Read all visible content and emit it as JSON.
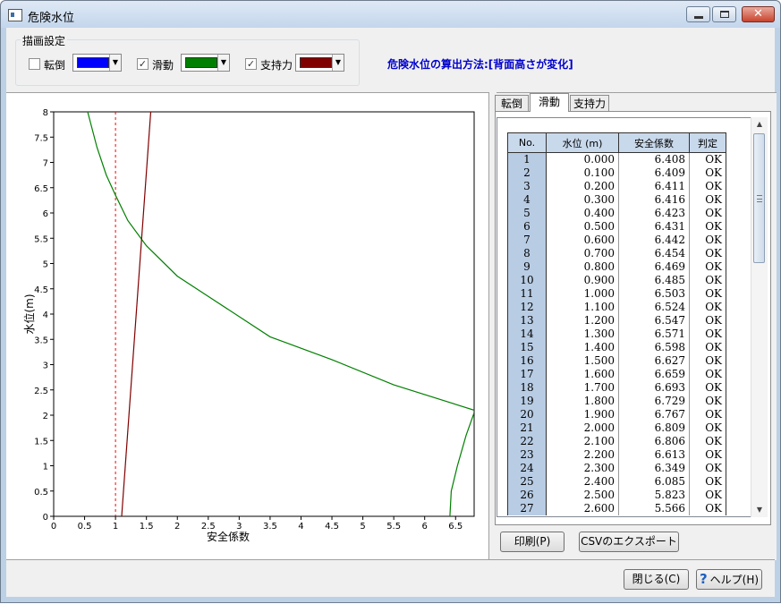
{
  "window": {
    "title": "危険水位",
    "minimize_glyph": "─",
    "maximize_glyph": "□",
    "close_glyph": "✕"
  },
  "settings": {
    "group_label": "描画設定",
    "items": [
      {
        "label": "転倒",
        "checked": false,
        "color": "#0000ff"
      },
      {
        "label": "滑動",
        "checked": true,
        "color": "#008000"
      },
      {
        "label": "支持力",
        "checked": true,
        "color": "#800000"
      }
    ],
    "check_glyph": "✓",
    "dropdown_glyph": "▼"
  },
  "method_text": "危険水位の算出方法:[背面高さが変化]",
  "chart_data": {
    "type": "line",
    "xlabel": "安全係数",
    "ylabel": "水位(m)",
    "xlim": [
      0,
      6.8
    ],
    "ylim": [
      0,
      8
    ],
    "x_ticks": [
      "0",
      "0.5",
      "1",
      "1.5",
      "2",
      "2.5",
      "3",
      "3.5",
      "4",
      "4.5",
      "5",
      "5.5",
      "6",
      "6.5"
    ],
    "y_ticks": [
      "0",
      "0.5",
      "1",
      "1.5",
      "2",
      "2.5",
      "3",
      "3.5",
      "4",
      "4.5",
      "5",
      "5.5",
      "6",
      "6.5",
      "7",
      "7.5",
      "8"
    ],
    "reference_x": 1.0,
    "series": [
      {
        "color": "#008000",
        "points": [
          [
            6.408,
            0
          ],
          [
            6.43,
            0.5
          ],
          [
            6.53,
            1
          ],
          [
            6.67,
            1.6
          ],
          [
            6.8,
            2.05
          ]
        ]
      },
      {
        "color": "#008000",
        "points": [
          [
            6.8,
            2.1
          ],
          [
            5.5,
            2.6
          ],
          [
            4.5,
            3.1
          ],
          [
            3.5,
            3.55
          ],
          [
            2.5,
            4.35
          ],
          [
            2.0,
            4.75
          ],
          [
            1.5,
            5.35
          ],
          [
            1.2,
            5.85
          ],
          [
            1.0,
            6.35
          ],
          [
            0.85,
            6.75
          ],
          [
            0.7,
            7.3
          ],
          [
            0.55,
            8
          ]
        ]
      },
      {
        "color": "#800000",
        "points": [
          [
            1.1,
            0
          ],
          [
            1.57,
            8
          ]
        ]
      }
    ]
  },
  "tabs": [
    {
      "label": "転倒"
    },
    {
      "label": "滑動"
    },
    {
      "label": "支持力"
    }
  ],
  "table": {
    "headers": [
      "No.",
      "水位 (m)",
      "安全係数",
      "判定"
    ],
    "rows": [
      [
        "1",
        "0.000",
        "6.408",
        "OK"
      ],
      [
        "2",
        "0.100",
        "6.409",
        "OK"
      ],
      [
        "3",
        "0.200",
        "6.411",
        "OK"
      ],
      [
        "4",
        "0.300",
        "6.416",
        "OK"
      ],
      [
        "5",
        "0.400",
        "6.423",
        "OK"
      ],
      [
        "6",
        "0.500",
        "6.431",
        "OK"
      ],
      [
        "7",
        "0.600",
        "6.442",
        "OK"
      ],
      [
        "8",
        "0.700",
        "6.454",
        "OK"
      ],
      [
        "9",
        "0.800",
        "6.469",
        "OK"
      ],
      [
        "10",
        "0.900",
        "6.485",
        "OK"
      ],
      [
        "11",
        "1.000",
        "6.503",
        "OK"
      ],
      [
        "12",
        "1.100",
        "6.524",
        "OK"
      ],
      [
        "13",
        "1.200",
        "6.547",
        "OK"
      ],
      [
        "14",
        "1.300",
        "6.571",
        "OK"
      ],
      [
        "15",
        "1.400",
        "6.598",
        "OK"
      ],
      [
        "16",
        "1.500",
        "6.627",
        "OK"
      ],
      [
        "17",
        "1.600",
        "6.659",
        "OK"
      ],
      [
        "18",
        "1.700",
        "6.693",
        "OK"
      ],
      [
        "19",
        "1.800",
        "6.729",
        "OK"
      ],
      [
        "20",
        "1.900",
        "6.767",
        "OK"
      ],
      [
        "21",
        "2.000",
        "6.809",
        "OK"
      ],
      [
        "22",
        "2.100",
        "6.806",
        "OK"
      ],
      [
        "23",
        "2.200",
        "6.613",
        "OK"
      ],
      [
        "24",
        "2.300",
        "6.349",
        "OK"
      ],
      [
        "25",
        "2.400",
        "6.085",
        "OK"
      ],
      [
        "26",
        "2.500",
        "5.823",
        "OK"
      ],
      [
        "27",
        "2.600",
        "5.566",
        "OK"
      ]
    ]
  },
  "scrollbar": {
    "up_glyph": "▲",
    "down_glyph": "▼"
  },
  "buttons": {
    "print": "印刷(P)",
    "csv": "CSVのエクスポート",
    "close": "閉じる(C)",
    "help": "ヘルプ(H)",
    "help_glyph": "?"
  }
}
